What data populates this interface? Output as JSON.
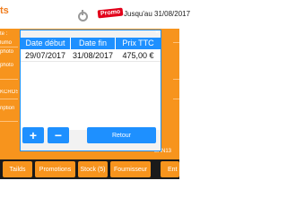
{
  "header": {
    "brand_text": "ts",
    "promo_badge": "Promo",
    "promo_until": "Jusqu'au 31/08/2017"
  },
  "background_fields": [
    "te :",
    "lumo",
    "photo",
    "photo",
    "KCROS",
    "ription"
  ],
  "bottom_right_text": "EAN13",
  "nav": {
    "items": [
      {
        "label": "Tailds"
      },
      {
        "label": "Promotions"
      },
      {
        "label": "Stock (5)"
      },
      {
        "label": "Fournisseur"
      },
      {
        "label": "Ent"
      }
    ]
  },
  "modal": {
    "close_glyph": "×",
    "table": {
      "columns": [
        "Date début",
        "Date fin",
        "Prix TTC"
      ],
      "rows": [
        [
          "29/07/2017",
          "31/08/2017",
          "475,00 €"
        ]
      ]
    },
    "buttons": {
      "add": "+",
      "remove": "−",
      "return": "Retour"
    }
  },
  "colors": {
    "accent_orange": "#f7941d",
    "accent_blue": "#1e90ff",
    "promo_red": "#e2001a",
    "nav_dark": "#1a1a1a"
  },
  "icons": [
    "power-icon"
  ]
}
